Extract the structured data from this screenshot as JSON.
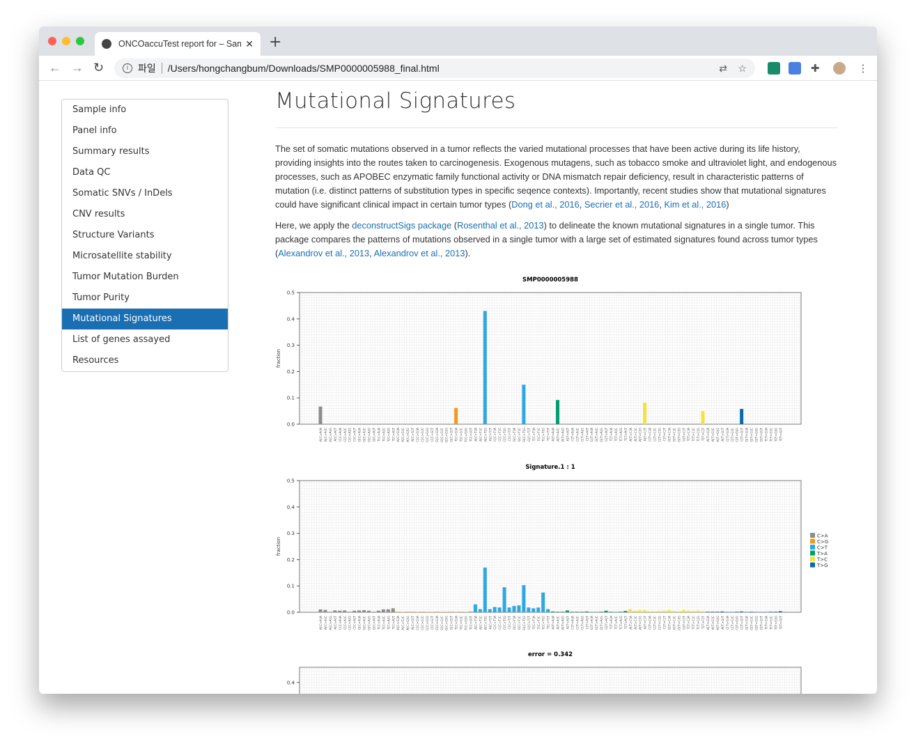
{
  "browser": {
    "tab_title": "ONCOaccuTest report for – Sam",
    "url_scheme_label": "파일",
    "url": "/Users/hongchangbum/Downloads/SMP0000005988_final.html"
  },
  "sidebar": {
    "items": [
      {
        "label": "Sample info"
      },
      {
        "label": "Panel info"
      },
      {
        "label": "Summary results"
      },
      {
        "label": "Data QC"
      },
      {
        "label": "Somatic SNVs / InDels"
      },
      {
        "label": "CNV results"
      },
      {
        "label": "Structure Variants"
      },
      {
        "label": "Microsatellite stability"
      },
      {
        "label": "Tumor Mutation Burden"
      },
      {
        "label": "Tumor Purity"
      },
      {
        "label": "Mutational Signatures",
        "active": true
      },
      {
        "label": "List of genes assayed"
      },
      {
        "label": "Resources"
      }
    ]
  },
  "main": {
    "title": "Mutational Signatures",
    "paragraphs": [
      [
        {
          "text": "The set of somatic mutations observed in a tumor reflects the varied mutational processes that have been active during its life history, providing insights into the routes taken to carcinogenesis. Exogenous mutagens, such as tobacco smoke and ultraviolet light, and endogenous processes, such as APOBEC enzymatic family functional activity or DNA mismatch repair deficiency, result in characteristic patterns of mutation (i.e. distinct patterns of substitution types in specific seqence contexts). Importantly, recent studies show that mutational signatures could have significant clinical impact in certain tumor types ("
        },
        {
          "text": "Dong et al., 2016",
          "link": true
        },
        {
          "text": ", "
        },
        {
          "text": "Secrier et al., 2016",
          "link": true
        },
        {
          "text": ", "
        },
        {
          "text": "Kim et al., 2016",
          "link": true
        },
        {
          "text": ")"
        }
      ],
      [
        {
          "text": "Here, we apply the "
        },
        {
          "text": "deconstructSigs package",
          "link": true
        },
        {
          "text": " ("
        },
        {
          "text": "Rosenthal et al., 2013",
          "link": true
        },
        {
          "text": ") to delineate the known mutational signatures in a single tumor. This package compares the patterns of mutations observed in a single tumor with a large set of estimated signatures found across tumor types ("
        },
        {
          "text": "Alexandrov et al., 2013",
          "link": true
        },
        {
          "text": ", "
        },
        {
          "text": "Alexandrov et al., 2013",
          "link": true
        },
        {
          "text": ")."
        }
      ]
    ]
  },
  "chart_data": [
    {
      "type": "bar",
      "title": "SMP0000005988",
      "ylabel": "fraction",
      "ylim": [
        0,
        0.5
      ],
      "yticks": [
        "0.0",
        "0.1",
        "0.2",
        "0.3",
        "0.4",
        "0.5"
      ],
      "grid": true,
      "values": [
        0.067,
        0,
        0,
        0,
        0,
        0,
        0,
        0,
        0,
        0,
        0,
        0,
        0,
        0,
        0,
        0,
        0,
        0,
        0,
        0,
        0,
        0,
        0,
        0,
        0,
        0,
        0,
        0,
        0.062,
        0,
        0,
        0,
        0,
        0,
        0.43,
        0,
        0,
        0,
        0,
        0,
        0,
        0,
        0.15,
        0,
        0,
        0,
        0,
        0,
        0,
        0.092,
        0,
        0,
        0,
        0,
        0,
        0,
        0,
        0,
        0,
        0,
        0,
        0,
        0,
        0,
        0,
        0,
        0,
        0.082,
        0,
        0,
        0,
        0,
        0,
        0,
        0,
        0,
        0,
        0,
        0,
        0.05,
        0,
        0,
        0,
        0,
        0,
        0,
        0,
        0.058,
        0,
        0,
        0,
        0,
        0,
        0,
        0,
        0
      ]
    },
    {
      "type": "bar",
      "title": "Signature.1 : 1",
      "ylabel": "fraction",
      "ylim": [
        0,
        0.5
      ],
      "yticks": [
        "0.0",
        "0.1",
        "0.2",
        "0.3",
        "0.4",
        "0.5"
      ],
      "grid": true,
      "legend": "right",
      "values": [
        0.011,
        0.009,
        0.002,
        0.007,
        0.006,
        0.007,
        0.002,
        0.006,
        0.007,
        0.008,
        0.006,
        0.002,
        0.006,
        0.011,
        0.011,
        0.015,
        0.002,
        0.001,
        0.002,
        0.002,
        0.001,
        0.002,
        0.001,
        0.001,
        0.002,
        0.001,
        0.001,
        0.002,
        0.001,
        0.002,
        0.001,
        0.003,
        0.03,
        0.012,
        0.17,
        0.012,
        0.02,
        0.018,
        0.095,
        0.018,
        0.024,
        0.026,
        0.103,
        0.018,
        0.015,
        0.018,
        0.075,
        0.012,
        0.003,
        0.002,
        0.002,
        0.007,
        0.002,
        0.002,
        0.002,
        0.003,
        0.001,
        0.001,
        0.002,
        0.006,
        0.002,
        0.001,
        0.002,
        0.005,
        0.012,
        0.006,
        0.008,
        0.008,
        0.004,
        0.004,
        0.005,
        0.006,
        0.008,
        0.005,
        0.004,
        0.008,
        0.006,
        0.005,
        0.006,
        0.004,
        0.002,
        0.002,
        0.002,
        0.003,
        0.001,
        0.001,
        0.002,
        0.003,
        0.001,
        0.002,
        0.001,
        0.001,
        0.001,
        0.002,
        0.002,
        0.004
      ]
    },
    {
      "type": "bar",
      "title": "error = 0.342",
      "yticks": [
        "0.4"
      ],
      "grid": true,
      "values": []
    }
  ],
  "categories": [
    "A[C>A]A",
    "A[C>A]C",
    "A[C>A]G",
    "A[C>A]T",
    "C[C>A]A",
    "C[C>A]C",
    "C[C>A]G",
    "C[C>A]T",
    "G[C>A]A",
    "G[C>A]C",
    "G[C>A]G",
    "G[C>A]T",
    "T[C>A]A",
    "T[C>A]C",
    "T[C>A]G",
    "T[C>A]T",
    "A[C>G]A",
    "A[C>G]C",
    "A[C>G]G",
    "A[C>G]T",
    "C[C>G]A",
    "C[C>G]C",
    "C[C>G]G",
    "C[C>G]T",
    "G[C>G]A",
    "G[C>G]C",
    "G[C>G]G",
    "G[C>G]T",
    "T[C>G]A",
    "T[C>G]C",
    "T[C>G]G",
    "T[C>G]T",
    "A[C>T]A",
    "A[C>T]C",
    "A[C>T]G",
    "A[C>T]T",
    "C[C>T]A",
    "C[C>T]C",
    "C[C>T]G",
    "C[C>T]T",
    "G[C>T]A",
    "G[C>T]C",
    "G[C>T]G",
    "G[C>T]T",
    "T[C>T]A",
    "T[C>T]C",
    "T[C>T]G",
    "T[C>T]T",
    "A[T>A]A",
    "A[T>A]C",
    "A[T>A]G",
    "A[T>A]T",
    "C[T>A]A",
    "C[T>A]C",
    "C[T>A]G",
    "C[T>A]T",
    "G[T>A]A",
    "G[T>A]C",
    "G[T>A]G",
    "G[T>A]T",
    "T[T>A]A",
    "T[T>A]C",
    "T[T>A]G",
    "T[T>A]T",
    "A[T>C]A",
    "A[T>C]C",
    "A[T>C]G",
    "A[T>C]T",
    "C[T>C]A",
    "C[T>C]C",
    "C[T>C]G",
    "C[T>C]T",
    "G[T>C]A",
    "G[T>C]C",
    "G[T>C]G",
    "G[T>C]T",
    "T[T>C]A",
    "T[T>C]C",
    "T[T>C]G",
    "T[T>C]T",
    "A[T>G]A",
    "A[T>G]C",
    "A[T>G]G",
    "A[T>G]T",
    "C[T>G]A",
    "C[T>G]C",
    "C[T>G]G",
    "C[T>G]T",
    "G[T>G]A",
    "G[T>G]C",
    "G[T>G]G",
    "G[T>G]T",
    "T[T>G]A",
    "T[T>G]C",
    "T[T>G]G",
    "T[T>G]T"
  ],
  "legend": [
    {
      "label": "C>A",
      "color": "#8c8c8c"
    },
    {
      "label": "C>G",
      "color": "#f29a1c"
    },
    {
      "label": "C>T",
      "color": "#2ea8e0"
    },
    {
      "label": "T>A",
      "color": "#009e6e"
    },
    {
      "label": "T>C",
      "color": "#f0e442"
    },
    {
      "label": "T>G",
      "color": "#0a6aae"
    }
  ]
}
